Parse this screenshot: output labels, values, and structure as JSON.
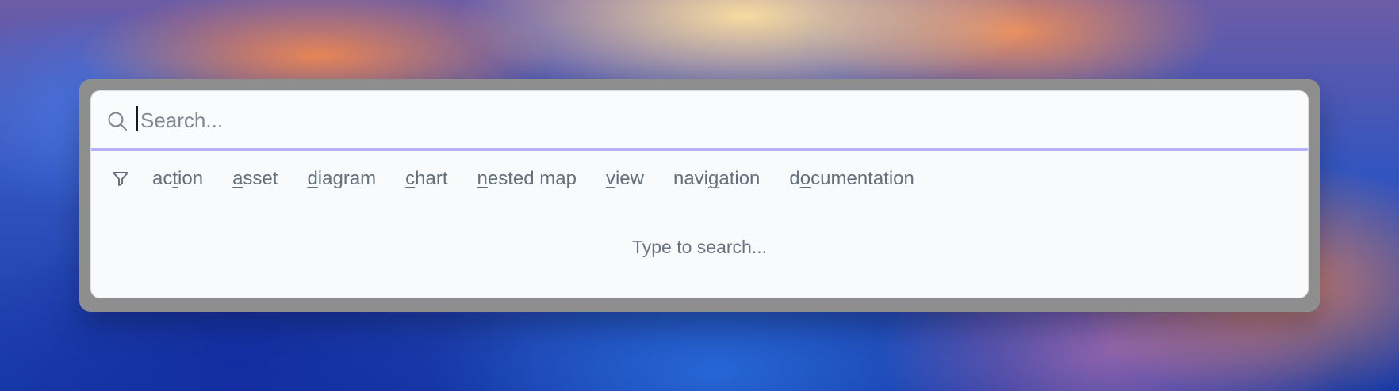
{
  "search": {
    "placeholder": "Search..."
  },
  "filters": [
    {
      "prefix": "ac",
      "hotkey": "t",
      "suffix": "ion"
    },
    {
      "prefix": "",
      "hotkey": "a",
      "suffix": "sset"
    },
    {
      "prefix": "",
      "hotkey": "d",
      "suffix": "iagram"
    },
    {
      "prefix": "",
      "hotkey": "c",
      "suffix": "hart"
    },
    {
      "prefix": "",
      "hotkey": "n",
      "suffix": "ested map"
    },
    {
      "prefix": "",
      "hotkey": "v",
      "suffix": "iew"
    },
    {
      "prefix": "navi",
      "hotkey": "g",
      "suffix": "ation"
    },
    {
      "prefix": "d",
      "hotkey": "o",
      "suffix": "cumentation"
    }
  ],
  "status": {
    "message": "Type to search..."
  },
  "icons": {
    "search": "search-icon",
    "filter": "filter-icon"
  },
  "colors": {
    "accent": "#b9b0ff",
    "panel_bg": "#f8fafc",
    "text_muted": "#64707d"
  }
}
